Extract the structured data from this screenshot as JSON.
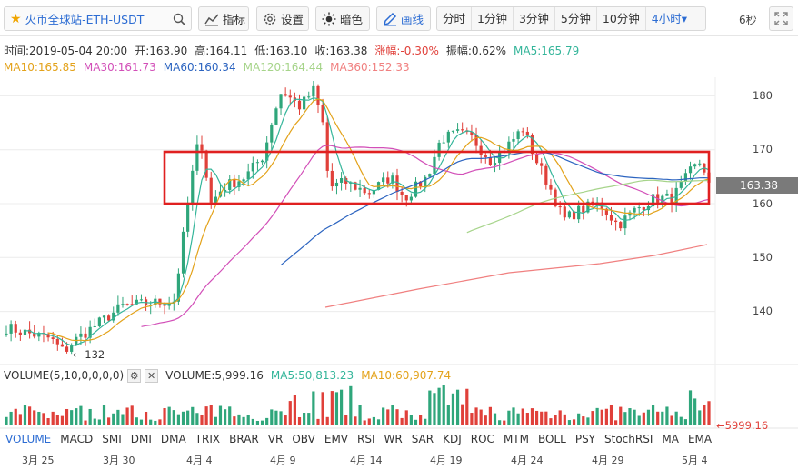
{
  "toolbar": {
    "symbol": "火币全球站-ETH-USDT",
    "indicators": "指标",
    "settings": "设置",
    "dark": "暗色",
    "draw": "画线",
    "periods": [
      "分时",
      "1分钟",
      "3分钟",
      "5分钟",
      "10分钟",
      "4小时▾"
    ],
    "countdown": "6秒"
  },
  "info": {
    "time": "时间:2019-05-04 20:00",
    "open": "开:163.90",
    "high": "高:164.11",
    "low": "低:163.10",
    "close": "收:163.38",
    "change": "涨幅:-0.30%",
    "amplitude": "振幅:0.62%",
    "ma5": "MA5:165.79",
    "ma10": "MA10:165.85",
    "ma30": "MA30:161.73",
    "ma60": "MA60:160.34",
    "ma120": "MA120:164.44",
    "ma360": "MA360:152.33"
  },
  "price_axis": [
    "180",
    "170",
    "160",
    "150",
    "140"
  ],
  "price_tag": "163.38",
  "low_marker": "← 132",
  "volume": {
    "title": "VOLUME(5,10,0,0,0,0)",
    "gear": "⚙",
    "close": "✕",
    "value": "VOLUME:5,999.16",
    "ma5": "MA5:50,813.23",
    "ma10": "MA10:60,907.74",
    "tag": "←5999.16"
  },
  "indicator_tabs": [
    "VOLUME",
    "MACD",
    "SMI",
    "DMI",
    "DMA",
    "TRIX",
    "BRAR",
    "VR",
    "OBV",
    "EMV",
    "RSI",
    "WR",
    "SAR",
    "KDJ",
    "ROC",
    "MTM",
    "BOLL",
    "PSY",
    "StochRSI",
    "MA",
    "EMA"
  ],
  "date_labels": [
    "3月 25",
    "3月 30",
    "4月 4",
    "4月 9",
    "4月 14",
    "4月 19",
    "4月 24",
    "4月 29",
    "5月 4"
  ],
  "colors": {
    "up": "#2fa67b",
    "down": "#e0403a",
    "ma5": "#34b59a",
    "ma10": "#e3a21a",
    "ma30": "#d24fb8",
    "ma60": "#2c64c0",
    "ma120": "#a6d48a",
    "ma360": "#f08080",
    "highlight": "#e02020"
  }
}
